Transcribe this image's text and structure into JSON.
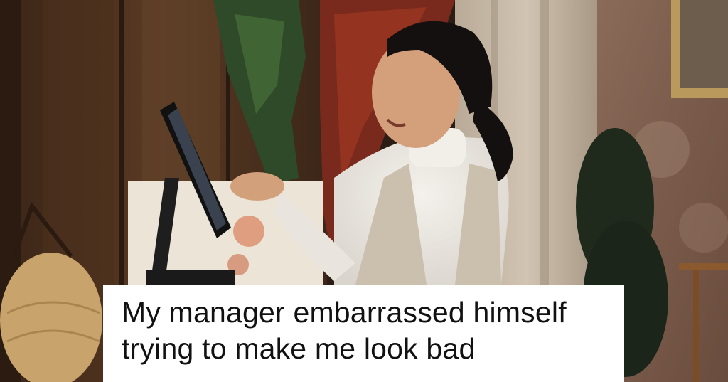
{
  "image": {
    "description_hidden": true
  },
  "caption": {
    "text": "My manager embarrassed himself trying to make me look bad"
  }
}
